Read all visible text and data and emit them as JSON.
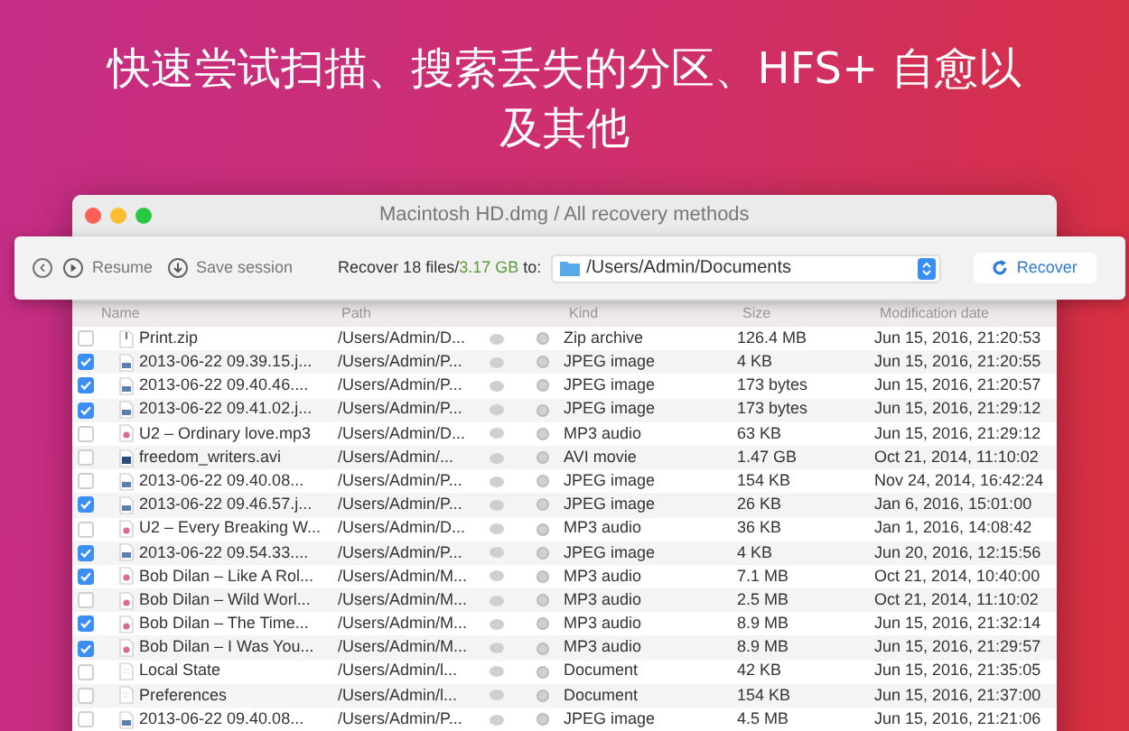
{
  "headline": "快速尝试扫描、搜索丢失的分区、HFS+ 自愈以及其他",
  "window": {
    "title": "Macintosh HD.dmg / All recovery methods"
  },
  "toolbar": {
    "back": "‹",
    "resume": "Resume",
    "save_session": "Save session",
    "recover_prefix": "Recover 18 files/",
    "recover_size": "3.17 GB",
    "recover_suffix": " to:",
    "destination": "/Users/Admin/Documents",
    "recover_button": "Recover"
  },
  "table": {
    "columns": [
      "Name",
      "Path",
      "Kind",
      "Size",
      "Modification date"
    ],
    "rows": [
      {
        "checked": false,
        "kind": "zip",
        "name": "Print.zip",
        "path": "/Users/Admin/D...",
        "kind_label": "Zip archive",
        "size": "126.4 MB",
        "date": "Jun 15, 2016, 21:20:53"
      },
      {
        "checked": true,
        "kind": "image",
        "name": "2013-06-22 09.39.15.j...",
        "path": "/Users/Admin/P...",
        "kind_label": "JPEG image",
        "size": "4 KB",
        "date": "Jun 15, 2016, 21:20:55"
      },
      {
        "checked": true,
        "kind": "image",
        "name": "2013-06-22 09.40.46....",
        "path": "/Users/Admin/P...",
        "kind_label": "JPEG image",
        "size": "173 bytes",
        "date": "Jun 15, 2016, 21:20:57"
      },
      {
        "checked": true,
        "kind": "image",
        "name": "2013-06-22 09.41.02.j...",
        "path": "/Users/Admin/P...",
        "kind_label": "JPEG image",
        "size": "173 bytes",
        "date": "Jun 15, 2016, 21:29:12"
      },
      {
        "checked": false,
        "kind": "audio",
        "name": "U2 – Ordinary love.mp3",
        "path": "/Users/Admin/D...",
        "kind_label": "MP3 audio",
        "size": "63 KB",
        "date": "Jun 15, 2016, 21:29:12"
      },
      {
        "checked": false,
        "kind": "video",
        "name": "freedom_writers.avi",
        "path": "/Users/Admin/...",
        "kind_label": "AVI movie",
        "size": "1.47 GB",
        "date": "Oct 21, 2014, 11:10:02"
      },
      {
        "checked": false,
        "kind": "image",
        "name": "2013-06-22 09.40.08...",
        "path": "/Users/Admin/P...",
        "kind_label": "JPEG image",
        "size": "154 KB",
        "date": "Nov 24, 2014, 16:42:24"
      },
      {
        "checked": true,
        "kind": "image",
        "name": "2013-06-22 09.46.57.j...",
        "path": "/Users/Admin/P...",
        "kind_label": "JPEG image",
        "size": "26 KB",
        "date": "Jan 6, 2016, 15:01:00"
      },
      {
        "checked": false,
        "kind": "audio",
        "name": "U2 – Every Breaking W...",
        "path": "/Users/Admin/D...",
        "kind_label": "MP3 audio",
        "size": "36 KB",
        "date": "Jan 1, 2016, 14:08:42"
      },
      {
        "checked": true,
        "kind": "image",
        "name": "2013-06-22 09.54.33....",
        "path": "/Users/Admin/P...",
        "kind_label": "JPEG image",
        "size": "4 KB",
        "date": "Jun 20, 2016, 12:15:56"
      },
      {
        "checked": true,
        "kind": "audio",
        "name": "Bob Dilan – Like A Rol...",
        "path": "/Users/Admin/M...",
        "kind_label": "MP3 audio",
        "size": "7.1 MB",
        "date": "Oct 21, 2014, 10:40:00"
      },
      {
        "checked": false,
        "kind": "audio",
        "name": "Bob Dilan – Wild Worl...",
        "path": "/Users/Admin/M...",
        "kind_label": "MP3 audio",
        "size": "2.5 MB",
        "date": "Oct 21, 2014, 11:10:02"
      },
      {
        "checked": true,
        "kind": "audio",
        "name": "Bob Dilan – The Time...",
        "path": "/Users/Admin/M...",
        "kind_label": "MP3 audio",
        "size": "8.9 MB",
        "date": "Jun 15, 2016, 21:32:14"
      },
      {
        "checked": true,
        "kind": "audio",
        "name": "Bob Dilan – I Was You...",
        "path": "/Users/Admin/M...",
        "kind_label": "MP3 audio",
        "size": "8.9 MB",
        "date": "Jun 15, 2016, 21:29:57"
      },
      {
        "checked": false,
        "kind": "document",
        "name": "Local State",
        "path": "/Users/Admin/l...",
        "kind_label": "Document",
        "size": "42 KB",
        "date": "Jun 15, 2016, 21:35:05"
      },
      {
        "checked": false,
        "kind": "document",
        "name": "Preferences",
        "path": "/Users/Admin/l...",
        "kind_label": "Document",
        "size": "154 KB",
        "date": "Jun 15, 2016, 21:37:00"
      },
      {
        "checked": false,
        "kind": "image",
        "name": "2013-06-22 09.40.08...",
        "path": "/Users/Admin/P...",
        "kind_label": "JPEG image",
        "size": "4.5 MB",
        "date": "Jun 15, 2016, 21:21:06"
      }
    ]
  }
}
